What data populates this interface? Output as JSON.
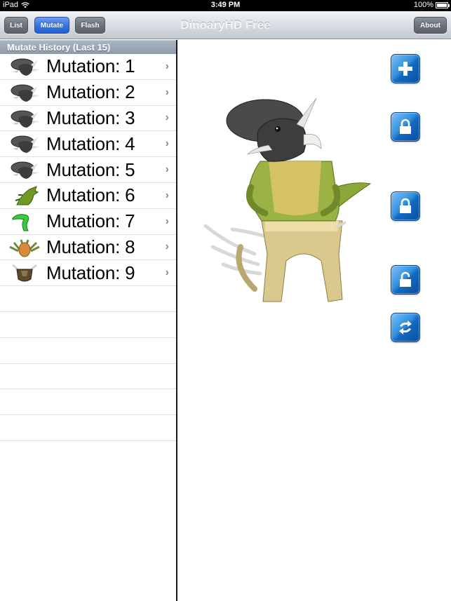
{
  "status_bar": {
    "device": "iPad",
    "time": "3:49 PM",
    "battery": "100%"
  },
  "nav": {
    "title": "DinoaryHD Free",
    "buttons": [
      {
        "label": "List",
        "active": false
      },
      {
        "label": "Mutate",
        "active": true
      },
      {
        "label": "Flash",
        "active": false
      }
    ],
    "about_label": "About"
  },
  "history": {
    "header": "Mutate History (Last 15)",
    "items": [
      {
        "label": "Mutation: 1",
        "icon": "triceratops-head-icon"
      },
      {
        "label": "Mutation: 2",
        "icon": "triceratops-head-icon"
      },
      {
        "label": "Mutation: 3",
        "icon": "triceratops-head-icon"
      },
      {
        "label": "Mutation: 4",
        "icon": "triceratops-head-icon"
      },
      {
        "label": "Mutation: 5",
        "icon": "triceratops-head-icon"
      },
      {
        "label": "Mutation: 6",
        "icon": "green-spiky-dino-icon"
      },
      {
        "label": "Mutation: 7",
        "icon": "green-long-neck-dino-icon"
      },
      {
        "label": "Mutation: 8",
        "icon": "frilled-dino-icon"
      },
      {
        "label": "Mutation: 9",
        "icon": "horned-dino-head-icon"
      }
    ],
    "empty_rows": 6
  },
  "controls": [
    {
      "name": "add-button",
      "icon": "plus-icon"
    },
    {
      "name": "lock-head-button",
      "icon": "lock-closed-icon"
    },
    {
      "name": "lock-body-button",
      "icon": "lock-closed-icon"
    },
    {
      "name": "lock-legs-button",
      "icon": "lock-open-icon"
    },
    {
      "name": "shuffle-button",
      "icon": "refresh-icon"
    }
  ],
  "colors": {
    "accent_blue": "#2f8fe0",
    "active_tab": "#3a74e0"
  }
}
